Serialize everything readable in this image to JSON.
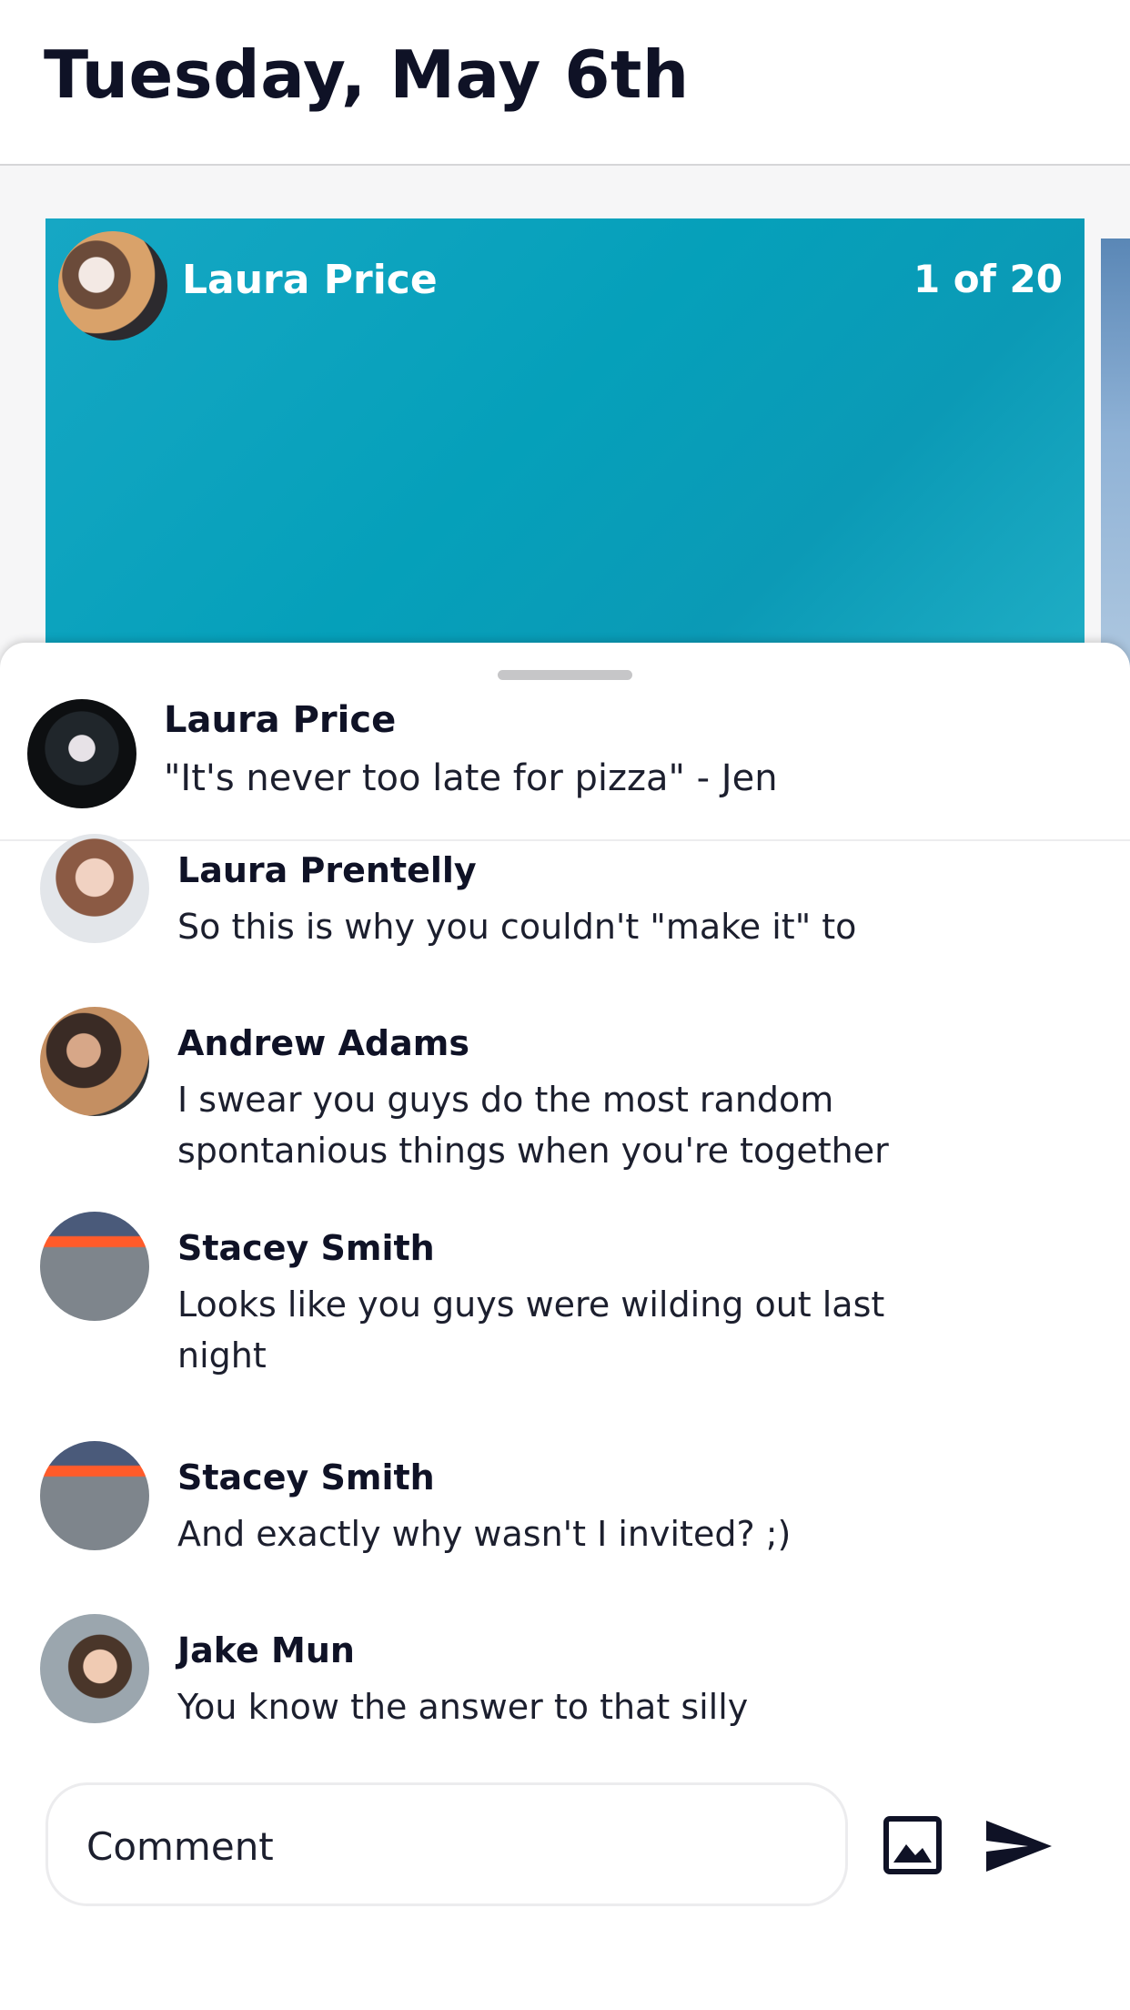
{
  "header": {
    "title": "Tuesday, May 6th"
  },
  "card": {
    "author": "Laura Price",
    "counter": "1 of 20"
  },
  "post": {
    "author": "Laura Price",
    "caption": "\"It's never too late for pizza\" - Jen"
  },
  "comments": [
    {
      "name": "Laura Prentelly",
      "text": "So this is why you couldn't \"make it\" to"
    },
    {
      "name": "Andrew Adams",
      "text": "I swear you guys do the most random spontanious things when you're together"
    },
    {
      "name": "Stacey Smith",
      "text": "Looks like you guys were wilding out last night"
    },
    {
      "name": "Stacey Smith",
      "text": "And exactly why wasn't I invited? ;)"
    },
    {
      "name": "Jake Mun",
      "text": "You know the answer to that silly"
    }
  ],
  "composer": {
    "placeholder": "Comment"
  },
  "icons": {
    "image": "image-icon",
    "send": "send-icon"
  },
  "colors": {
    "card_bg": "#05a0ba",
    "text": "#0f1226"
  }
}
